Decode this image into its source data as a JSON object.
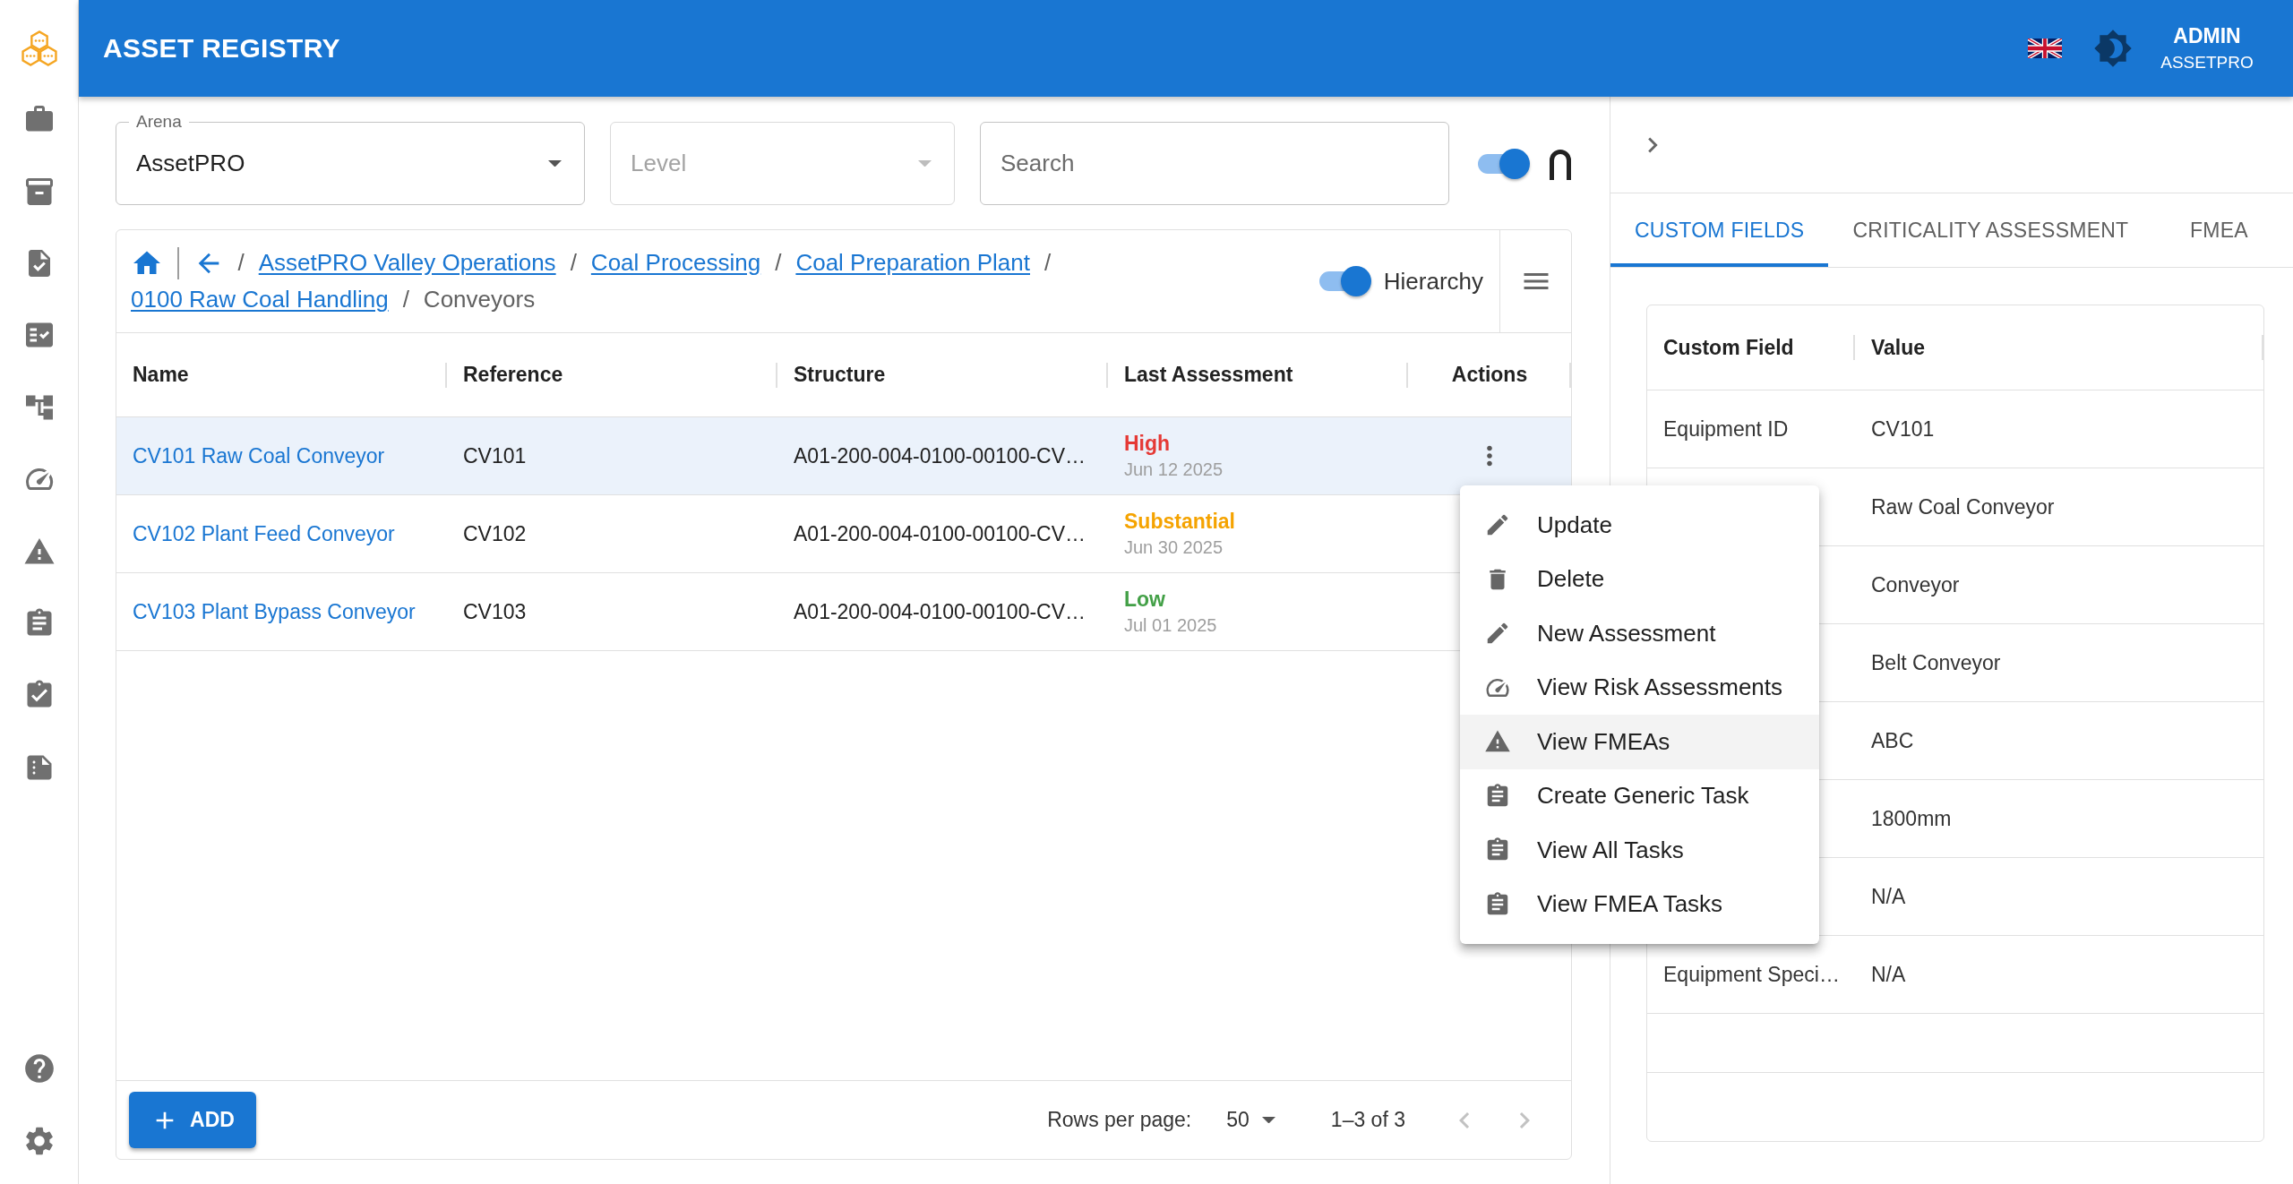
{
  "app_bar": {
    "title": "ASSET REGISTRY",
    "user_name": "ADMIN",
    "organization": "ASSETPRO"
  },
  "filters": {
    "arena": {
      "label": "Arena",
      "value": "AssetPRO"
    },
    "level": {
      "placeholder": "Level",
      "disabled": true
    },
    "search": {
      "placeholder": "Search"
    },
    "intersect_toggle": {
      "on": true
    }
  },
  "breadcrumb": {
    "trail": [
      {
        "separator": "/",
        "label": "AssetPRO Valley Operations",
        "kind": "link"
      },
      {
        "separator": "/",
        "label": "Coal Processing",
        "kind": "link"
      },
      {
        "separator": "/",
        "label": "Coal Preparation Plant",
        "kind": "link"
      },
      {
        "separator": "/",
        "label": "0100 Raw Coal Handling",
        "kind": "link"
      },
      {
        "separator": "/",
        "label": "Conveyors",
        "kind": "current"
      }
    ]
  },
  "hierarchy_toggle": {
    "label": "Hierarchy",
    "on": true
  },
  "table": {
    "columns": [
      "Name",
      "Reference",
      "Structure",
      "Last Assessment",
      "Actions"
    ],
    "rows": [
      {
        "name": "CV101 Raw Coal Conveyor",
        "reference": "CV101",
        "structure": "A01-200-004-0100-00100-CV…",
        "rating": "High",
        "color": "#e53935",
        "date": "Jun 12 2025",
        "selected": true
      },
      {
        "name": "CV102 Plant Feed Conveyor",
        "reference": "CV102",
        "structure": "A01-200-004-0100-00100-CV…",
        "rating": "Substantial",
        "color": "#f5a300",
        "date": "Jun 30 2025",
        "selected": false
      },
      {
        "name": "CV103 Plant Bypass Conveyor",
        "reference": "CV103",
        "structure": "A01-200-004-0100-00100-CV…",
        "rating": "Low",
        "color": "#43a047",
        "date": "Jul 01 2025",
        "selected": false
      }
    ]
  },
  "actions_menu": {
    "items": [
      {
        "label": "Update",
        "selected": false
      },
      {
        "label": "Delete",
        "selected": false
      },
      {
        "label": "New Assessment",
        "selected": false
      },
      {
        "label": "View Risk Assessments",
        "selected": false
      },
      {
        "label": "View FMEAs",
        "selected": true
      },
      {
        "label": "Create Generic Task",
        "selected": false
      },
      {
        "label": "View All Tasks",
        "selected": false
      },
      {
        "label": "View FMEA Tasks",
        "selected": false
      }
    ]
  },
  "footer": {
    "add_button": "ADD",
    "rows_per_page_label": "Rows per page:",
    "rows_per_page": "50",
    "range": "1–3 of 3",
    "previous_disabled": true,
    "next_disabled": true
  },
  "details_panel": {
    "tabs": [
      {
        "label": "CUSTOM FIELDS",
        "selected": true
      },
      {
        "label": "CRITICALITY ASSESSMENT",
        "selected": false
      },
      {
        "label": "FMEA",
        "selected": false
      }
    ],
    "custom_fields": {
      "columns": [
        "Custom Field",
        "Value"
      ],
      "rows": [
        {
          "field": "Equipment ID",
          "value": "CV101"
        },
        {
          "value": "Raw Coal Conveyor"
        },
        {
          "value": "Conveyor"
        },
        {
          "value": "Belt Conveyor"
        },
        {
          "value": "ABC"
        },
        {
          "value": "1800mm"
        },
        {
          "value": "N/A"
        },
        {
          "field": "Equipment Speci…",
          "value": "N/A"
        }
      ]
    }
  }
}
